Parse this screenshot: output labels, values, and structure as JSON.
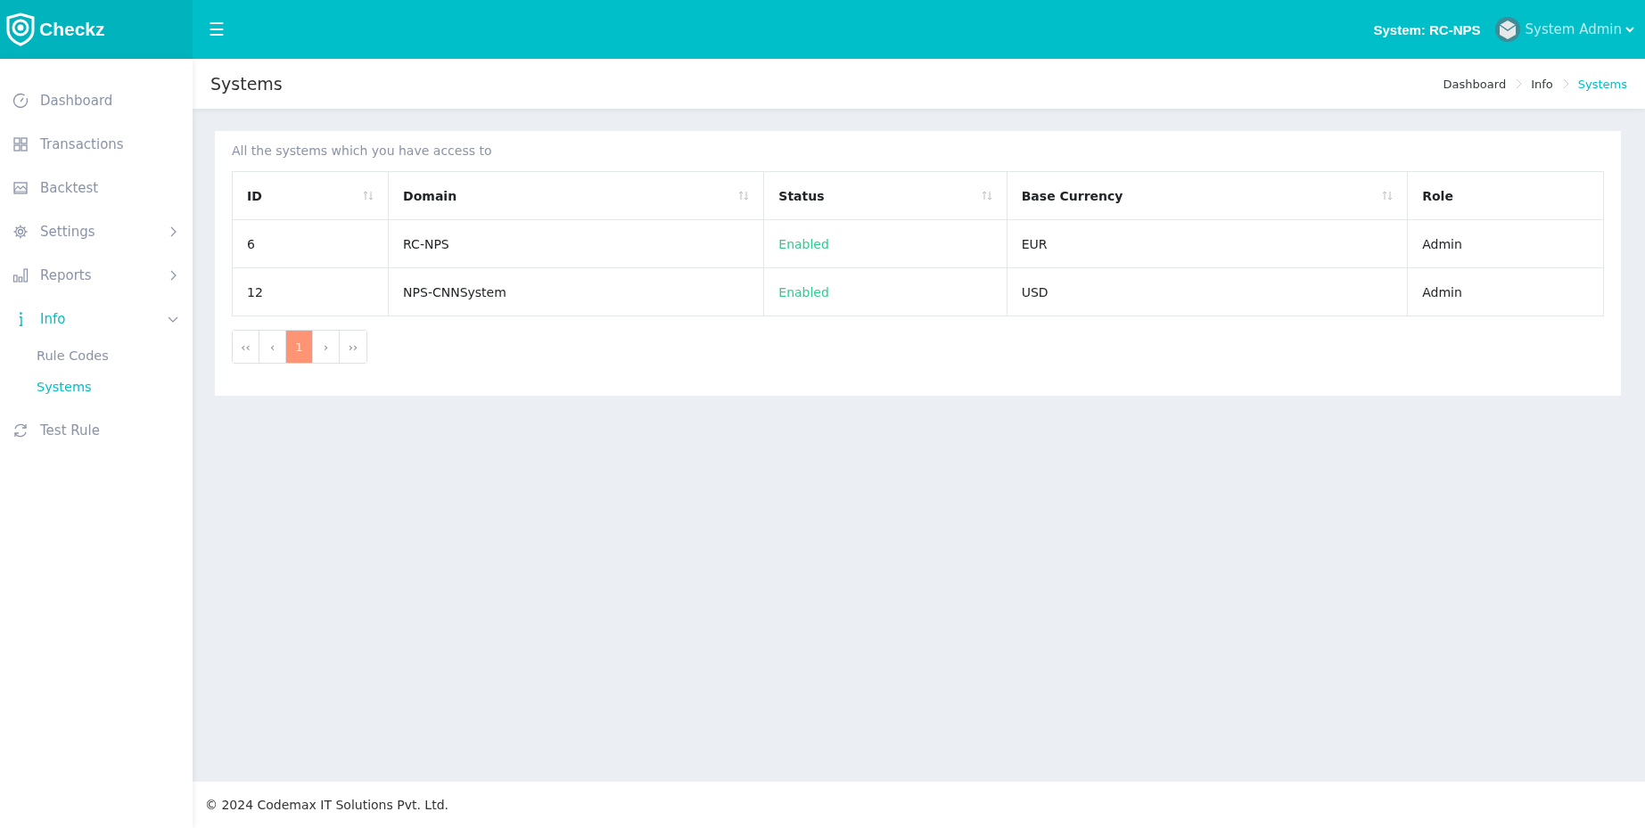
{
  "brand": {
    "name": "Checkz"
  },
  "topbar": {
    "menu_glyph": "☰",
    "system_label": "System: RC-NPS",
    "user": "System Admin"
  },
  "sidebar": {
    "items": [
      {
        "label": "Dashboard",
        "selected": false
      },
      {
        "label": "Transactions",
        "selected": false
      },
      {
        "label": "Backtest",
        "selected": false
      },
      {
        "label": "Settings",
        "selected": false,
        "expanded": false
      },
      {
        "label": "Reports",
        "selected": false,
        "expanded": false
      },
      {
        "label": "Info",
        "selected": true,
        "expanded": true,
        "children": [
          {
            "label": "Rule Codes",
            "selected": false
          },
          {
            "label": "Systems",
            "selected": true
          }
        ]
      },
      {
        "label": "Test Rule",
        "selected": false
      }
    ]
  },
  "page_header": {
    "title": "Systems",
    "breadcrumb": [
      {
        "label": "Dashboard",
        "selected": false
      },
      {
        "label": "Info",
        "selected": false
      },
      {
        "label": "Systems",
        "selected": true
      }
    ]
  },
  "card": {
    "description": "All the systems which you have access to",
    "table": {
      "columns": [
        {
          "label": "ID",
          "sortable": true
        },
        {
          "label": "Domain",
          "sortable": true
        },
        {
          "label": "Status",
          "sortable": true
        },
        {
          "label": "Base Currency",
          "sortable": true
        },
        {
          "label": "Role",
          "sortable": false
        }
      ],
      "rows": [
        {
          "cells": [
            "6",
            "RC-NPS",
            "Enabled",
            "EUR",
            "Admin"
          ],
          "enabled": true
        },
        {
          "cells": [
            "12",
            "NPS-CNNSystem",
            "Enabled",
            "USD",
            "Admin"
          ],
          "enabled": true
        }
      ]
    },
    "pagination": [
      {
        "label": "‹‹",
        "selected": false
      },
      {
        "label": "‹",
        "selected": false
      },
      {
        "label": "1",
        "selected": true
      },
      {
        "label": "›",
        "selected": false
      },
      {
        "label": "››",
        "selected": false
      }
    ]
  },
  "footer": {
    "text": "© 2024 Codemax IT Solutions Pvt. Ltd."
  }
}
